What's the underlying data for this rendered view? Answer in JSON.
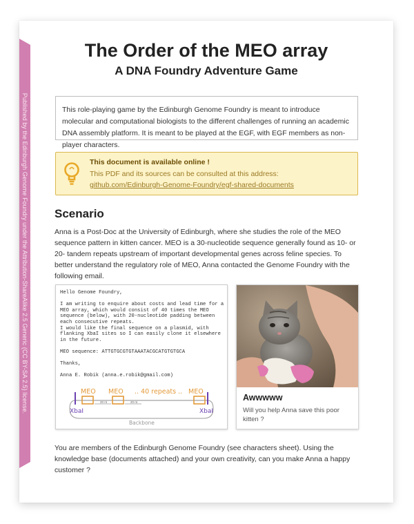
{
  "sidebar": {
    "license_text": "Published by the Edinburgh Genome Foundry under the Attribution-ShareAlike 2.5 Generic (CC BY-SA 2.5) license."
  },
  "header": {
    "title": "The Order of the MEO array",
    "subtitle": "A DNA Foundry Adventure Game"
  },
  "intro": {
    "text": "This role-playing game by the Edinburgh Genome Foundry is meant to introduce molecular and computational biologists to the different challenges of running an academic DNA assembly platform. It is meant to be played at the EGF, with EGF members as non-player characters."
  },
  "note": {
    "icon": "lightbulb-icon",
    "heading": "This document is available online !",
    "line": "This PDF and its sources can be consulted at this address:",
    "link": "github.com/Edinburgh-Genome-Foundry/egf-shared-documents"
  },
  "scenario": {
    "heading": "Scenario",
    "paragraph": "Anna is a Post-Doc at the University of Edinburgh, where she studies the role of the MEO sequence pattern in kitten cancer. MEO is a 30-nucleotide sequence generally found as 10- or 20- tandem repeats upstream of important developmental genes across feline species. To better understand the regulatory role of MEO, Anna contacted the Genome Foundry with the following email.",
    "closing": "You are members of the Edinburgh Genome Foundry (see characters sheet). Using the knowledge base (documents attached) and your own creativity, can you make Anna a happy customer ?"
  },
  "email": {
    "body": "Hello Genome Foundry,\n\nI am writing to enquire about costs and lead time for a MEO array, which would consist of 40 times the MEO sequence (below), with 20-nucleotide padding between each consecutive repeats.\nI would like the final sequence on a plasmid, with flanking XbaI sites so I can easily clone it elsewhere in the future.\n\nMEO sequence: ATTGTGCGTGTAAATACGCATGTGTGCA\n\nThanks,\n\nAnna E. Robik (anna.e.robik@gmail.com)",
    "diagram": {
      "meo_label_1": "MEO",
      "meo_label_2": "MEO",
      "repeats_label": ".. 40 repeats ..",
      "meo_label_3": "MEO",
      "spacer_1": "20 nt",
      "spacer_2": "20 nt",
      "site_left": "XbaI",
      "site_right": "XbaI",
      "backbone_label": "Backbone"
    }
  },
  "kitten_card": {
    "title": "Awwwww",
    "text": "Will you help Anna save this poor kitten ?"
  },
  "colors": {
    "ribbon": "#d17fb0",
    "note_bg": "#fdf3c8",
    "note_text": "#9a7a25",
    "diagram_orange": "#e39a3a",
    "diagram_purple": "#6a3fb0"
  }
}
